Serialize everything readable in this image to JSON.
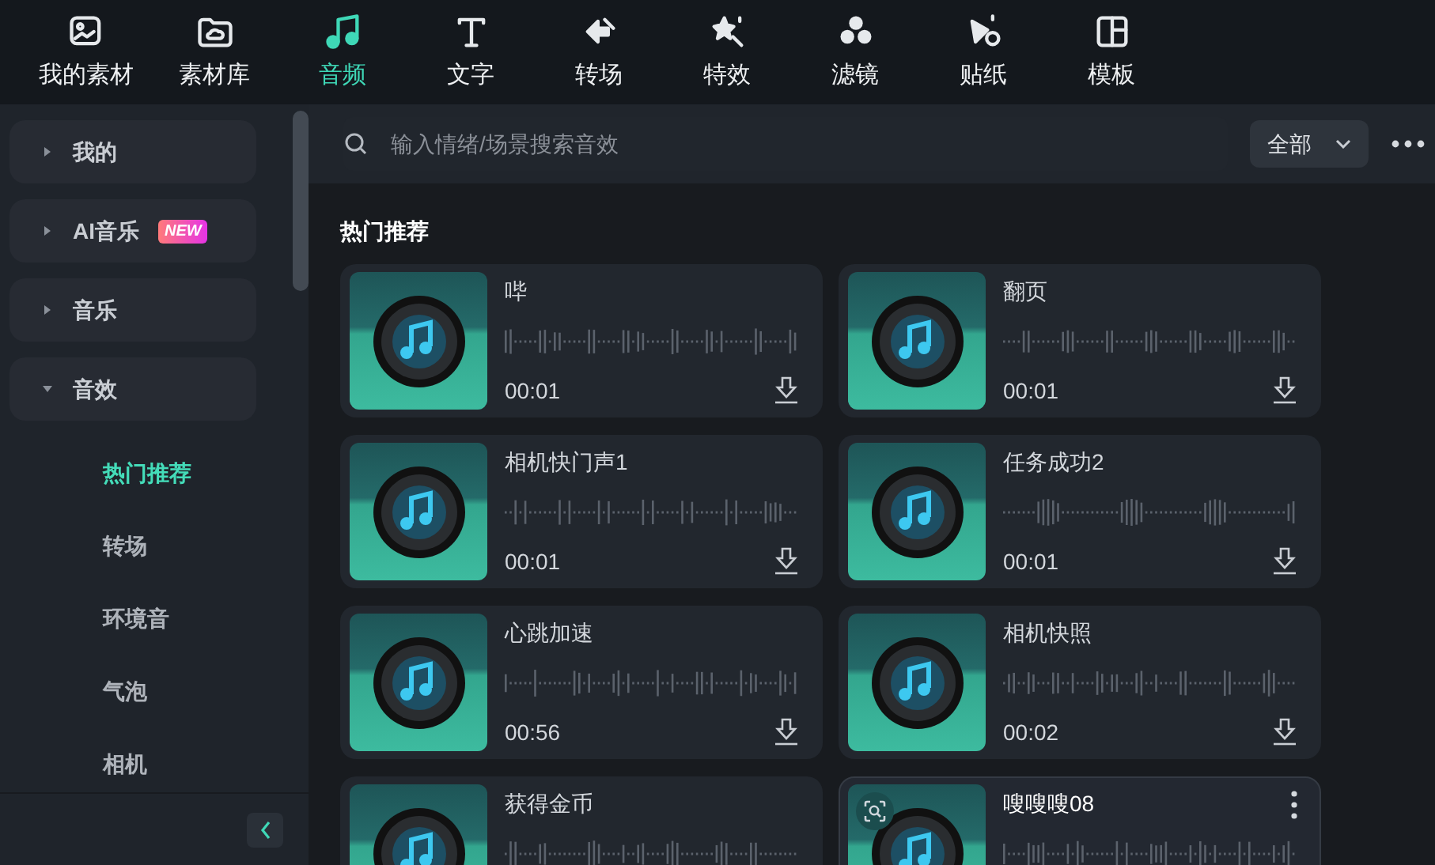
{
  "toolbar": [
    {
      "label": "我的素材",
      "selected": false
    },
    {
      "label": "素材库",
      "selected": false
    },
    {
      "label": "音频",
      "selected": true
    },
    {
      "label": "文字",
      "selected": false
    },
    {
      "label": "转场",
      "selected": false
    },
    {
      "label": "特效",
      "selected": false
    },
    {
      "label": "滤镜",
      "selected": false
    },
    {
      "label": "贴纸",
      "selected": false
    },
    {
      "label": "模板",
      "selected": false
    }
  ],
  "sidebar": {
    "items": [
      {
        "label": "我的",
        "expanded": false
      },
      {
        "label": "AI音乐",
        "badge": "NEW",
        "expanded": false
      },
      {
        "label": "音乐",
        "expanded": false
      },
      {
        "label": "音效",
        "expanded": true,
        "children": [
          {
            "label": "热门推荐",
            "selected": true
          },
          {
            "label": "转场",
            "selected": false
          },
          {
            "label": "环境音",
            "selected": false
          },
          {
            "label": "气泡",
            "selected": false
          },
          {
            "label": "相机",
            "selected": false
          }
        ]
      }
    ]
  },
  "search": {
    "placeholder": "输入情绪/场景搜索音效",
    "filter": "全部"
  },
  "section_title": "热门推荐",
  "cards": [
    {
      "title": "哔",
      "duration": "00:01",
      "hovered": false
    },
    {
      "title": "翻页",
      "duration": "00:01",
      "hovered": false
    },
    {
      "title": "相机快门声1",
      "duration": "00:01",
      "hovered": false
    },
    {
      "title": "任务成功2",
      "duration": "00:01",
      "hovered": false
    },
    {
      "title": "心跳加速",
      "duration": "00:56",
      "hovered": false
    },
    {
      "title": "相机快照",
      "duration": "00:02",
      "hovered": false
    },
    {
      "title": "获得金币",
      "hovered": false
    },
    {
      "title": "嗖嗖嗖08",
      "hovered": true
    }
  ]
}
